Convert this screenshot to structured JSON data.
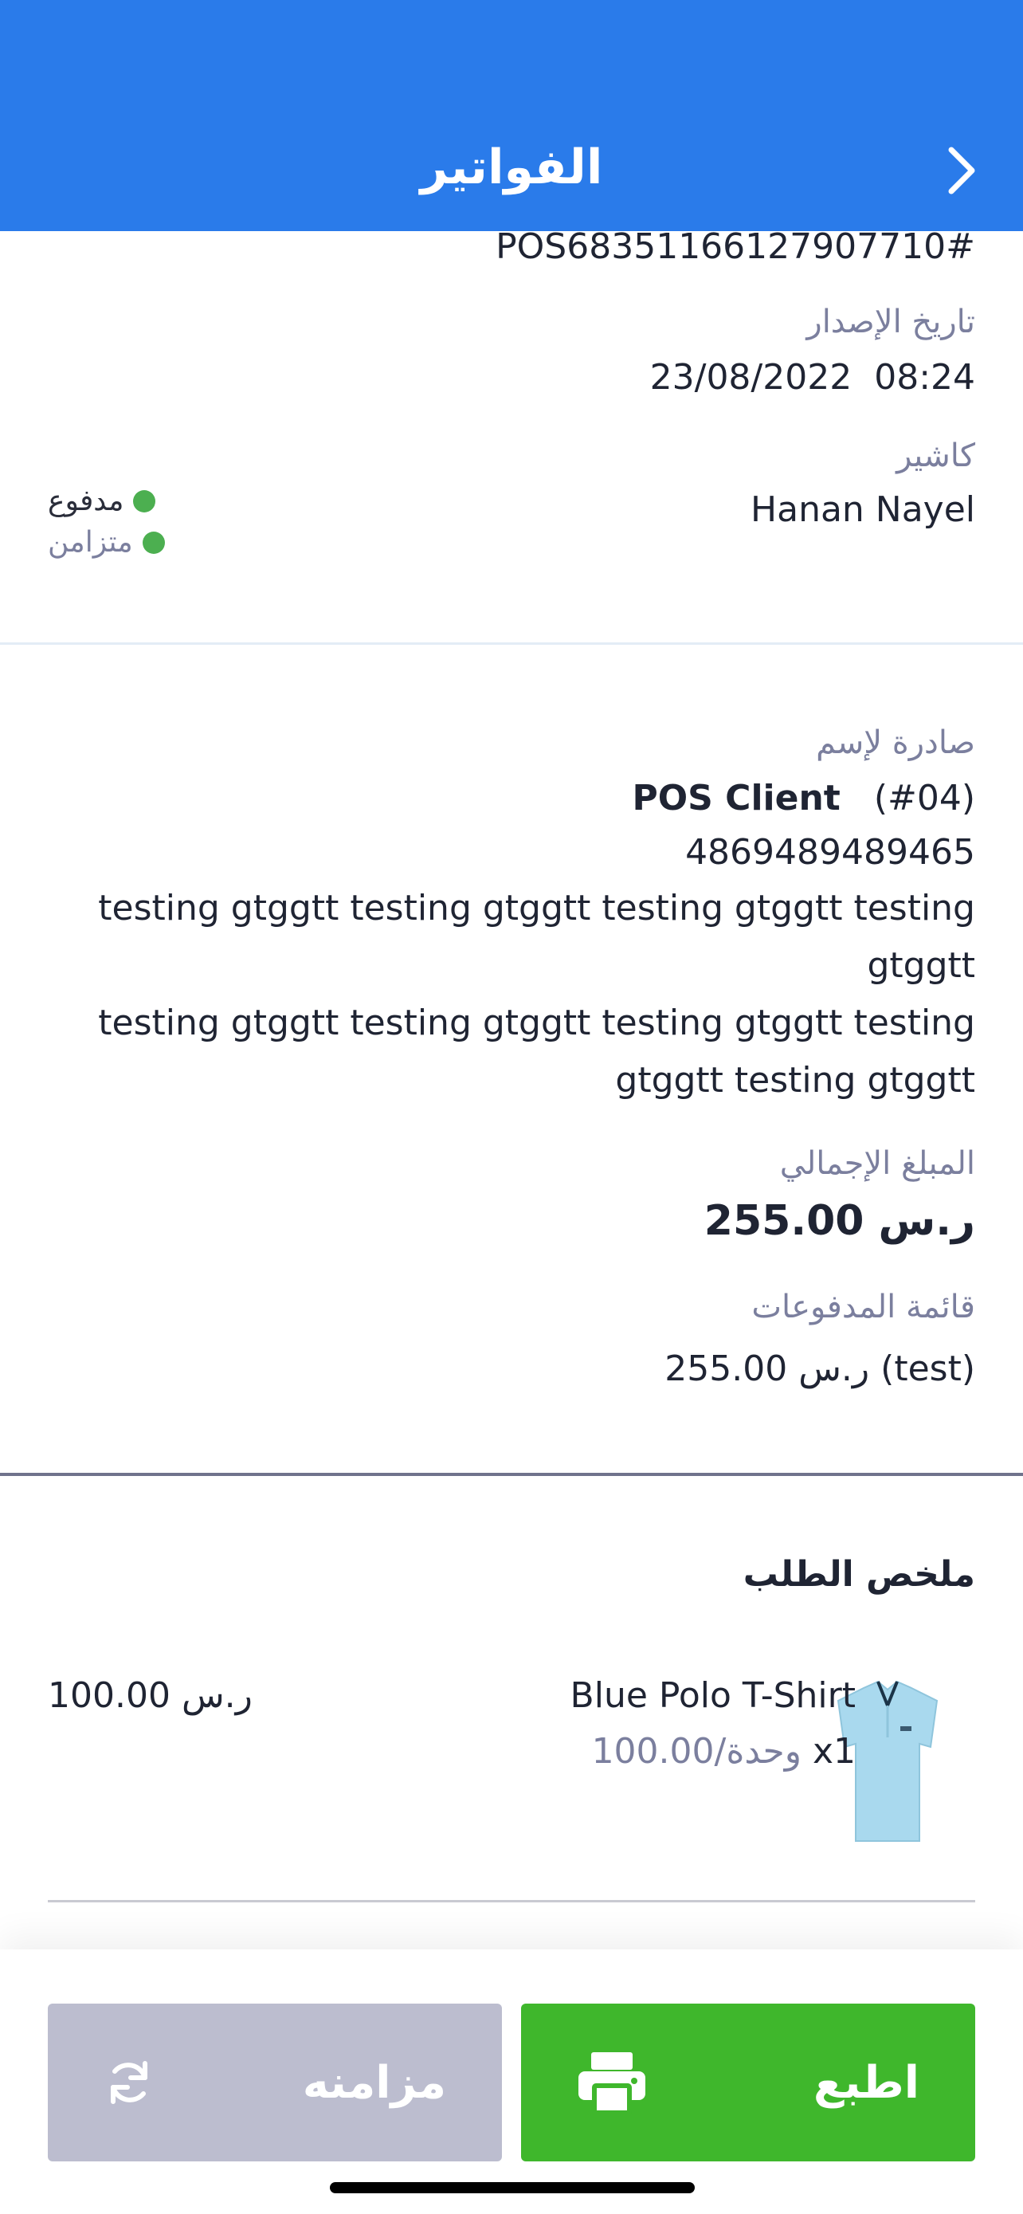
{
  "header": {
    "title": "الفواتير"
  },
  "invoice": {
    "number": "POS68351166127907710#",
    "issue_date_label": "تاريخ الإصدار",
    "issue_date": "23/08/2022  08:24",
    "cashier_label": "كاشير",
    "cashier": "Hanan Nayel",
    "status_paid": "مدفوع",
    "status_synced": "متزامن"
  },
  "client": {
    "issued_to_label": "صادرة لإسم",
    "name": "POS Client",
    "code": "(#04)",
    "phone": "4869489489465",
    "address_1": "testing gtggtt testing gtggtt testing gtggtt testing gtggtt",
    "address_2": "testing gtggtt testing gtggtt testing gtggtt testing gtggtt testing gtggtt",
    "total_label": "المبلغ الإجمالي",
    "total": "255.00 ر.س",
    "payments_label": "قائمة المدفوعات",
    "payment_entry": "255.00 ر.س (test)"
  },
  "order": {
    "summary_label": "ملخص الطلب",
    "items": [
      {
        "name": "Blue Polo T-Shirt",
        "qty": "x1",
        "unit_price": "100.00/وحدة",
        "line_total": "100.00 ر.س"
      }
    ]
  },
  "actions": {
    "print_label": "اطبع",
    "sync_label": "مزامنه"
  },
  "colors": {
    "header": "#2a7bea",
    "print_button": "#3fb72c",
    "sync_button": "#bcbdcf",
    "status_dot": "#4caf50"
  }
}
